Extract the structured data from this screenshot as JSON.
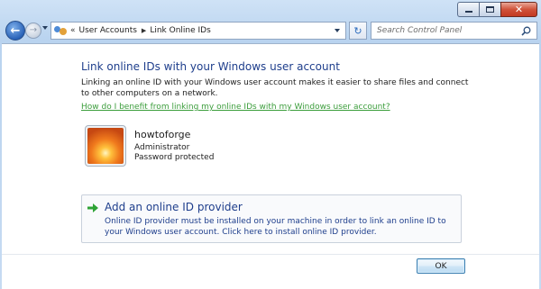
{
  "address_bar": {
    "breadcrumbs": [
      "User Accounts",
      "Link Online IDs"
    ]
  },
  "search": {
    "placeholder": "Search Control Panel"
  },
  "main": {
    "title": "Link online IDs with your Windows user account",
    "description": "Linking an online ID with your Windows user account makes it easier to share files and connect to other computers on a network.",
    "help_link": "How do I benefit from linking my online IDs with my Windows user account?"
  },
  "user": {
    "name": "howtoforge",
    "role": "Administrator",
    "status": "Password protected"
  },
  "provider": {
    "title": "Add an online ID provider",
    "description": "Online ID provider must be installed on your machine in order to link an online ID to your Windows user account. Click here to install online ID provider."
  },
  "footer": {
    "ok_label": "OK"
  },
  "icons": {
    "back": "back-arrow-icon",
    "forward": "forward-arrow-icon",
    "refresh": "refresh-icon",
    "search": "search-icon",
    "provider": "green-arrow-icon"
  },
  "colors": {
    "heading": "#1e3e8c",
    "link": "#3b9d3b",
    "close_button": "#c33a22"
  }
}
